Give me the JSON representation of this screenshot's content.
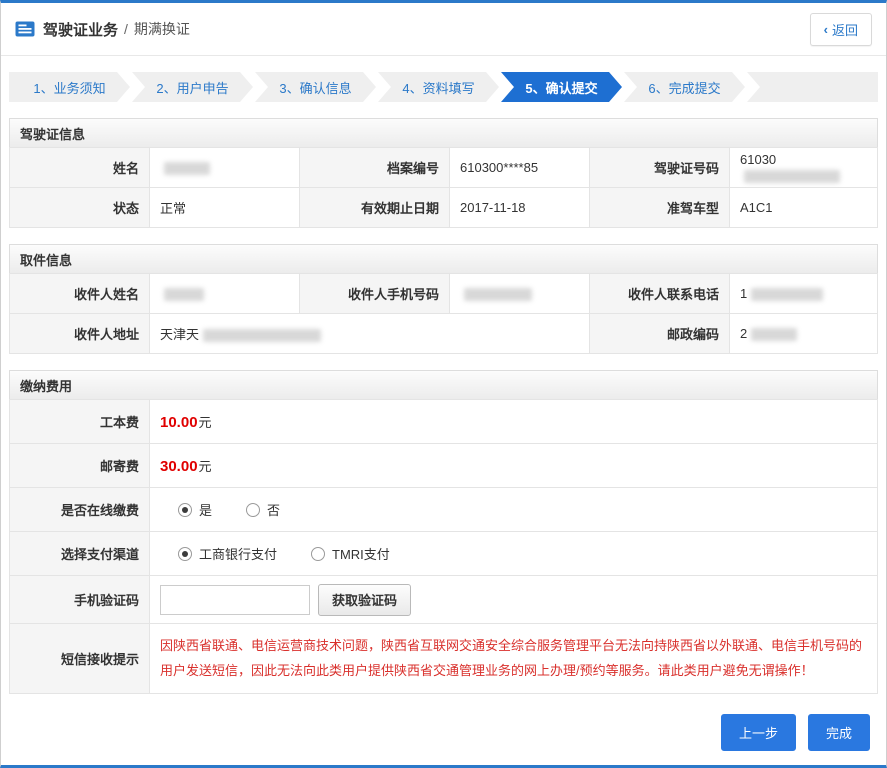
{
  "colors": {
    "accent": "#2b79c9",
    "active_step": "#1e6fd2",
    "price_red": "#e00000",
    "notice_red": "#d9302c"
  },
  "header": {
    "title": "驾驶证业务",
    "separator": "/",
    "subtitle": "期满换证",
    "back_chevron": "‹",
    "back_label": "返回"
  },
  "steps": [
    {
      "label": "1、业务须知"
    },
    {
      "label": "2、用户申告"
    },
    {
      "label": "3、确认信息"
    },
    {
      "label": "4、资料填写"
    },
    {
      "label": "5、确认提交"
    },
    {
      "label": "6、完成提交"
    }
  ],
  "license": {
    "title": "驾驶证信息",
    "name_label": "姓名",
    "file_no_label": "档案编号",
    "file_no_value": "610300****85",
    "license_no_label": "驾驶证号码",
    "license_no_prefix": "61030",
    "status_label": "状态",
    "status_value": "正常",
    "valid_until_label": "有效期止日期",
    "valid_until_value": "2017-11-18",
    "vehicle_class_label": "准驾车型",
    "vehicle_class_value": "A1C1"
  },
  "pickup": {
    "title": "取件信息",
    "name_label": "收件人姓名",
    "mobile_label": "收件人手机号码",
    "tel_label": "收件人联系电话",
    "tel_prefix": "1",
    "address_label": "收件人地址",
    "address_prefix": "天津天",
    "postcode_label": "邮政编码",
    "postcode_prefix": "2"
  },
  "fees": {
    "title": "缴纳费用",
    "cost_label": "工本费",
    "cost_value": "10.00",
    "postage_label": "邮寄费",
    "postage_value": "30.00",
    "unit": "元",
    "online_label": "是否在线缴费",
    "online_yes": "是",
    "online_no": "否",
    "channel_label": "选择支付渠道",
    "channel_icbc": "工商银行支付",
    "channel_tmri": "TMRI支付",
    "code_label": "手机验证码",
    "get_code": "获取验证码",
    "notice_label": "短信接收提示",
    "notice": "因陕西省联通、电信运营商技术问题，陕西省互联网交通安全综合服务管理平台无法向持陕西省以外联通、电信手机号码的用户发送短信，因此无法向此类用户提供陕西省交通管理业务的网上办理/预约等服务。请此类用户避免无谓操作！"
  },
  "footer": {
    "prev": "上一步",
    "finish": "完成"
  }
}
